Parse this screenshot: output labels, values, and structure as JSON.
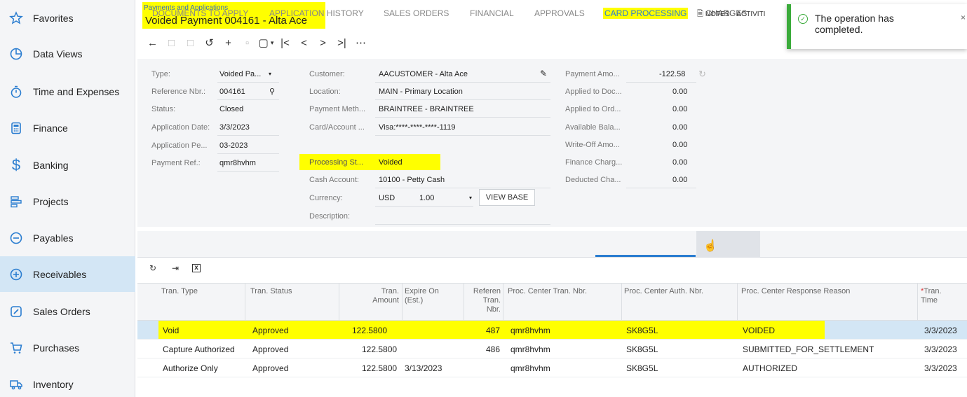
{
  "sidebar": {
    "items": [
      {
        "label": "Favorites",
        "icon": "star-icon"
      },
      {
        "label": "Data Views",
        "icon": "pie-chart-icon"
      },
      {
        "label": "Time and Expenses",
        "icon": "stopwatch-icon"
      },
      {
        "label": "Finance",
        "icon": "calculator-icon"
      },
      {
        "label": "Banking",
        "icon": "dollar-icon"
      },
      {
        "label": "Projects",
        "icon": "projects-icon"
      },
      {
        "label": "Payables",
        "icon": "minus-circle-icon"
      },
      {
        "label": "Receivables",
        "icon": "plus-circle-icon"
      },
      {
        "label": "Sales Orders",
        "icon": "pencil-square-icon"
      },
      {
        "label": "Purchases",
        "icon": "cart-icon"
      },
      {
        "label": "Inventory",
        "icon": "truck-icon"
      }
    ],
    "active": "Receivables"
  },
  "header": {
    "breadcrumb": "Payments and Applications",
    "title": "Voided Payment 004161 - Alta Ace",
    "notes": "NOTES",
    "activities": "ACTIVITI"
  },
  "toast": {
    "message": "The operation has completed.",
    "close": "×",
    "accent": "#3bab3b"
  },
  "form": {
    "col1": [
      {
        "label": "Type:",
        "value": "Voided Pa..."
      },
      {
        "label": "Reference Nbr.:",
        "value": "004161"
      },
      {
        "label": "Status:",
        "value": "Closed"
      },
      {
        "label": "Application Date:",
        "value": "3/3/2023"
      },
      {
        "label": "Application Pe...",
        "value": "03-2023"
      },
      {
        "label": "Payment Ref.:",
        "value": "qmr8hvhm"
      }
    ],
    "col2": [
      {
        "label": "Customer:",
        "value": "AACUSTOMER - Alta Ace"
      },
      {
        "label": "Location:",
        "value": "MAIN - Primary Location"
      },
      {
        "label": "Payment Meth...",
        "value": "BRAINTREE - BRAINTREE"
      },
      {
        "label": "Card/Account ...",
        "value": "Visa:****-****-****-1119"
      },
      {
        "label": "Processing St...",
        "value": "Voided"
      },
      {
        "label": "Cash Account:",
        "value": "10100 - Petty Cash"
      },
      {
        "label": "Currency:",
        "value": "USD"
      },
      {
        "label": "Description:",
        "value": ""
      }
    ],
    "currency_rate": "1.00",
    "view_base": "VIEW BASE",
    "col3": [
      {
        "label": "Payment Amo...",
        "value": "-122.58"
      },
      {
        "label": "Applied to Doc...",
        "value": "0.00"
      },
      {
        "label": "Applied to Ord...",
        "value": "0.00"
      },
      {
        "label": "Available Bala...",
        "value": "0.00"
      },
      {
        "label": "Write-Off Amo...",
        "value": "0.00"
      },
      {
        "label": "Finance Charg...",
        "value": "0.00"
      },
      {
        "label": "Deducted Cha...",
        "value": "0.00"
      }
    ]
  },
  "tabs": [
    "DOCUMENTS TO APPLY",
    "APPLICATION HISTORY",
    "SALES ORDERS",
    "FINANCIAL",
    "APPROVALS",
    "CARD PROCESSING",
    "CHARGES"
  ],
  "active_tab": "CARD PROCESSING",
  "table": {
    "headers": {
      "tran_type": "Tran. Type",
      "tran_status": "Tran. Status",
      "tran_amount": "Tran. Amount",
      "expire_on": "Expire On (Est.)",
      "ref_tran_nbr": "Referen Tran. Nbr.",
      "proc_center_tran_nbr": "Proc. Center Tran. Nbr.",
      "proc_center_auth_nbr": "Proc. Center Auth. Nbr.",
      "proc_center_response_reason": "Proc. Center Response Reason",
      "tran_time": "Tran. Time"
    },
    "rows": [
      {
        "type": "Void",
        "status": "Approved",
        "amount": "122.5800",
        "expire": "",
        "ref": "487",
        "tran_nbr": "qmr8hvhm",
        "auth_nbr": "SK8G5L",
        "reason": "VOIDED",
        "time": "3/3/2023"
      },
      {
        "type": "Capture Authorized",
        "status": "Approved",
        "amount": "122.5800",
        "expire": "",
        "ref": "486",
        "tran_nbr": "qmr8hvhm",
        "auth_nbr": "SK8G5L",
        "reason": "SUBMITTED_FOR_SETTLEMENT",
        "time": "3/3/2023"
      },
      {
        "type": "Authorize Only",
        "status": "Approved",
        "amount": "122.5800",
        "expire": "3/13/2023",
        "ref": "",
        "tran_nbr": "qmr8hvhm",
        "auth_nbr": "SK8G5L",
        "reason": "AUTHORIZED",
        "time": "3/3/2023"
      }
    ]
  },
  "colors": {
    "highlight": "#ffff00",
    "accent": "#2a7dd0",
    "selected_row": "#d3e6f5"
  }
}
